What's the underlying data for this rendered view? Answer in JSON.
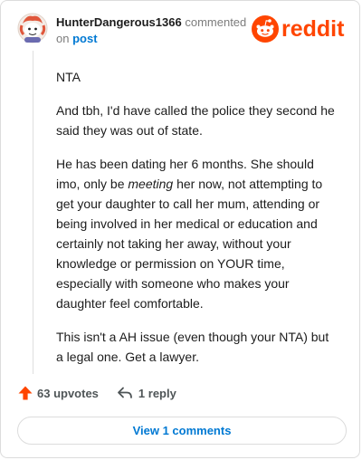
{
  "comment": {
    "username": "HunterDangerous1366",
    "action": "commented",
    "on_text": "on",
    "post_link": "post",
    "paragraphs": {
      "p1": "NTA",
      "p2": "And tbh, I'd have called the police they second he said they was out of state.",
      "p3_before": "He has been dating her 6 months. She should imo, only be ",
      "p3_emph": "meeting",
      "p3_after": " her now, not attempting to get your daughter to call her mum, attending or being involved in her medical or education and certainly not taking her away, without your knowledge or permission on YOUR time, especially with someone who makes your daughter feel comfortable.",
      "p4": "This isn't a AH issue (even though your NTA) but a legal one. Get a lawyer."
    }
  },
  "brand": {
    "wordmark": "reddit",
    "color": "#ff4500"
  },
  "actions": {
    "upvotes": "63 upvotes",
    "reply": "1 reply",
    "upvote_icon": "arrow-up-icon",
    "reply_icon": "reply-arrow-icon"
  },
  "footer": {
    "view_comments": "View 1 comments"
  },
  "colors": {
    "accent_link": "#0079d3",
    "upvote": "#ff4500"
  }
}
